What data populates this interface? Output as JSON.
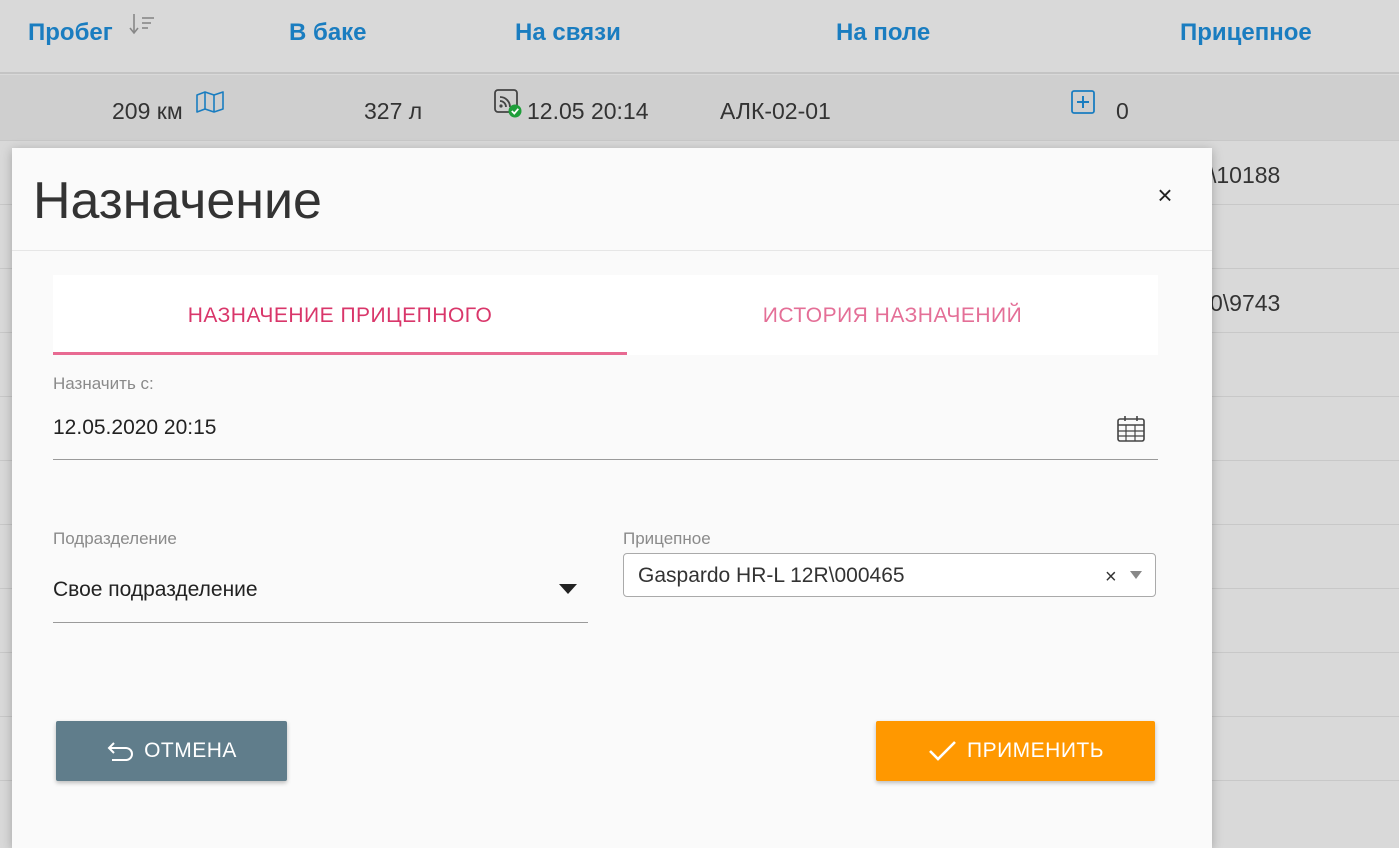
{
  "table": {
    "headers": {
      "mileage": "Пробег",
      "fuel": "В баке",
      "online": "На связи",
      "field": "На поле",
      "trailer": "Прицепное"
    },
    "row1": {
      "mileage": "209 км",
      "fuel": "327 л",
      "online": "12.05 20:14",
      "field": "АЛК-02-01",
      "trailer_count": "0"
    },
    "partial_cells": {
      "row2_trailer": "\\10188",
      "row4_trailer": "0\\9743"
    }
  },
  "modal": {
    "title": "Назначение",
    "close": "×",
    "tabs": [
      {
        "label": "НАЗНАЧЕНИЕ ПРИЦЕПНОГО",
        "active": true
      },
      {
        "label": "ИСТОРИЯ НАЗНАЧЕНИЙ",
        "active": false
      }
    ],
    "assign_from": {
      "label": "Назначить с:",
      "value": "12.05.2020 20:15"
    },
    "department": {
      "label": "Подразделение",
      "value": "Свое подразделение"
    },
    "trailer": {
      "label": "Прицепное",
      "value": "Gaspardo HR-L 12R\\000465",
      "clear": "×"
    },
    "buttons": {
      "cancel": "ОТМЕНА",
      "apply": "ПРИМЕНИТЬ"
    }
  },
  "colors": {
    "header_link": "#1a7dc0",
    "tab_active": "#d9366a",
    "cancel_button": "#607d8b",
    "apply_button": "#ff9800",
    "online_ok": "#1e9e3a"
  }
}
